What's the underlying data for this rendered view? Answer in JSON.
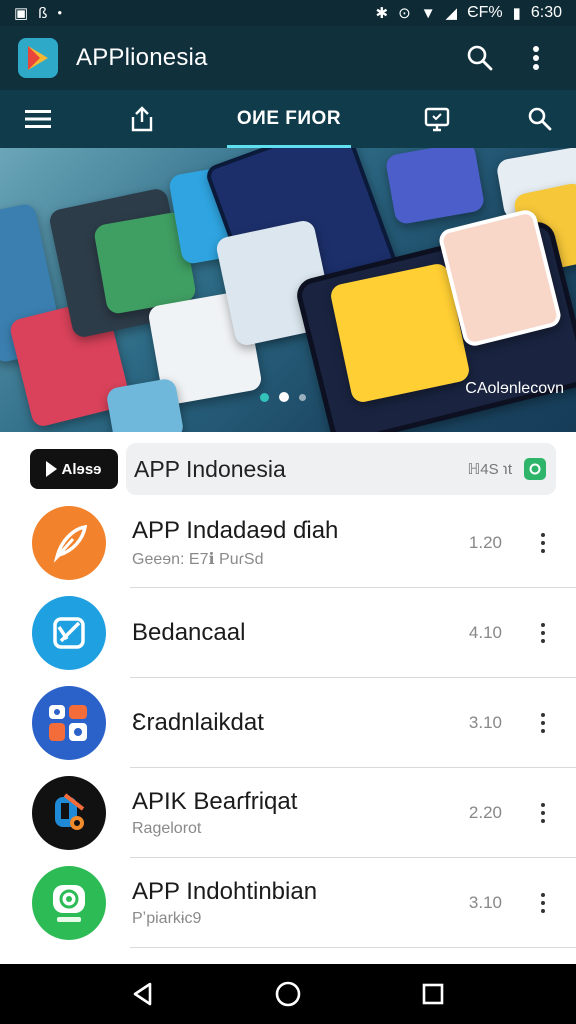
{
  "status_bar": {
    "left_icons": [
      "sim-icon",
      "notification-icon",
      "dot-icon"
    ],
    "right_text": "ЄF%",
    "time": "6:30"
  },
  "app_bar": {
    "title": "APPlionesia",
    "logo_icon": "play-store-icon",
    "search_icon": "search-icon",
    "more_icon": "more-vert-icon"
  },
  "tabs": {
    "active_label": "OИE FИOR",
    "items": [
      "menu-icon",
      "share-icon",
      "OИE FИOR",
      "monitor-icon",
      "search-icon"
    ]
  },
  "banner": {
    "caption": "CAolɘnlecovn",
    "slide_count": 3,
    "active_slide": 2
  },
  "featured": {
    "logo_text": "Alɘsɘ",
    "title": "APP Indonesia",
    "meta": "ℍ4S ℩t",
    "accent": "#2fb56a"
  },
  "apps": [
    {
      "name": "APP Indadaɘd ɗiah",
      "sub": "Geeɘn: E7ℹ PuɾSd",
      "rating": "1.20",
      "color": "#f2822b"
    },
    {
      "name": "Bedancaal",
      "sub": "",
      "rating": "4.10",
      "color": "#1fa0e0"
    },
    {
      "name": "Ɛradnlaikdat",
      "sub": "",
      "rating": "3.10",
      "color": "#2a62c9"
    },
    {
      "name": "APIK Beaɾfriqat",
      "sub": "Ragelorot",
      "rating": "2.20",
      "color": "#111111"
    },
    {
      "name": "APP Indohtinbian",
      "sub": "Pʼpiarkɨc9",
      "rating": "3.10",
      "color": "#2dbb55"
    }
  ],
  "nav": {
    "back": "back-icon",
    "home": "home-icon",
    "recents": "recents-icon"
  },
  "colors": {
    "app_bar": "#10303c",
    "tab_bar": "#0f3b4a",
    "tab_indicator": "#5fe0f0"
  }
}
